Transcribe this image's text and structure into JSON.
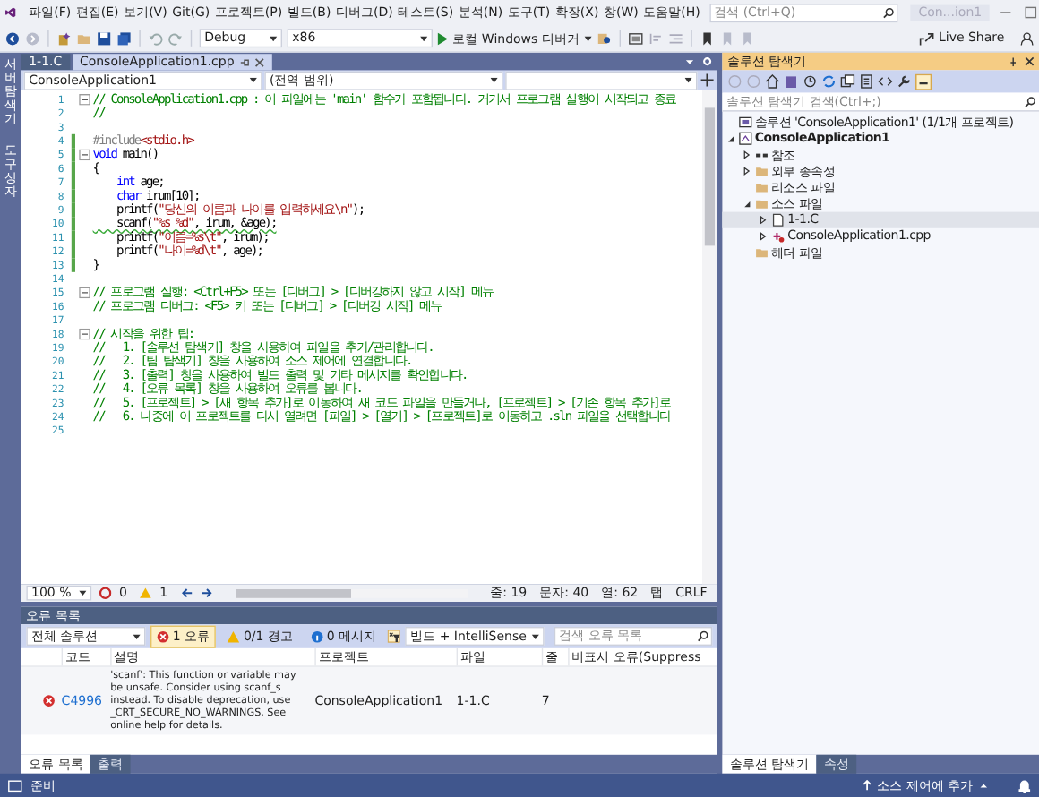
{
  "menu": [
    "파일(F)",
    "편집(E)",
    "보기(V)",
    "Git(G)",
    "프로젝트(P)",
    "빌드(B)",
    "디버그(D)",
    "테스트(S)",
    "분석(N)",
    "도구(T)",
    "확장(X)",
    "창(W)",
    "도움말(H)"
  ],
  "search": {
    "placeholder": "검색 (Ctrl+Q)"
  },
  "window": {
    "title": "Con...ion1"
  },
  "toolbar": {
    "configuration": "Debug",
    "platform": "x86",
    "run_label": "로컬 Windows 디버거",
    "live_share": "Live Share"
  },
  "side_strip": [
    "서버 탐색기",
    "도구 상자"
  ],
  "doc_tabs": [
    {
      "label": "1-1.C",
      "selected": false
    },
    {
      "label": "ConsoleApplication1.cpp",
      "selected": true
    }
  ],
  "nav_bar": {
    "project": "ConsoleApplication1",
    "scope": "(전역 범위)"
  },
  "code_lines": [
    {
      "number": "1",
      "fold": true,
      "changed": false,
      "segments": [
        {
          "kind": "comment",
          "text": "// ConsoleApplication1.cpp : 이 파일에는 'main' 함수가 포함됩니다. 거기서 프로그램 실행이 시작되고 종료"
        }
      ]
    },
    {
      "number": "2",
      "fold": false,
      "changed": false,
      "segments": [
        {
          "kind": "comment",
          "text": "//"
        }
      ]
    },
    {
      "number": "3",
      "fold": false,
      "changed": false
    },
    {
      "number": "4",
      "fold": false,
      "changed": true,
      "segments": [
        {
          "kind": "preproc",
          "text": "#include"
        },
        {
          "kind": "string",
          "text": "<stdio.h>"
        }
      ]
    },
    {
      "number": "5",
      "fold": true,
      "changed": true,
      "segments": [
        {
          "kind": "keyword",
          "text": "void"
        },
        {
          "kind": "plain",
          "text": " main()"
        }
      ]
    },
    {
      "number": "6",
      "fold": false,
      "changed": true,
      "segments": [
        {
          "kind": "plain",
          "text": "{"
        }
      ]
    },
    {
      "number": "7",
      "fold": false,
      "changed": true,
      "segments": [
        {
          "kind": "keyword",
          "text": "    int"
        },
        {
          "kind": "plain",
          "text": " age;"
        }
      ]
    },
    {
      "number": "8",
      "fold": false,
      "changed": true,
      "segments": [
        {
          "kind": "keyword",
          "text": "    char"
        },
        {
          "kind": "plain",
          "text": " irum[10];"
        }
      ]
    },
    {
      "number": "9",
      "fold": false,
      "changed": true,
      "segments": [
        {
          "kind": "plain",
          "text": "    printf("
        },
        {
          "kind": "string",
          "text": "\"당신의 이름과 나이를 입력하세요\\n\""
        },
        {
          "kind": "plain",
          "text": ");"
        }
      ]
    },
    {
      "number": "10",
      "fold": false,
      "changed": true,
      "squiggle": true,
      "segments": [
        {
          "kind": "plain",
          "text": "    scanf("
        },
        {
          "kind": "string",
          "text": "\"%s %d\""
        },
        {
          "kind": "plain",
          "text": ", irum, &age);"
        }
      ]
    },
    {
      "number": "11",
      "fold": false,
      "changed": true,
      "segments": [
        {
          "kind": "plain",
          "text": "    printf("
        },
        {
          "kind": "string",
          "text": "\"이름=%s\\t\""
        },
        {
          "kind": "plain",
          "text": ", irum);"
        }
      ]
    },
    {
      "number": "12",
      "fold": false,
      "changed": true,
      "segments": [
        {
          "kind": "plain",
          "text": "    printf("
        },
        {
          "kind": "string",
          "text": "\"나이=%d\\t\""
        },
        {
          "kind": "plain",
          "text": ", age);"
        }
      ]
    },
    {
      "number": "13",
      "fold": false,
      "changed": true,
      "segments": [
        {
          "kind": "plain",
          "text": "}"
        }
      ]
    },
    {
      "number": "14",
      "fold": false,
      "changed": false
    },
    {
      "number": "15",
      "fold": true,
      "changed": false,
      "segments": [
        {
          "kind": "comment",
          "text": "// 프로그램 실행: <Ctrl+F5> 또는 [디버그] > [디버깅하지 않고 시작] 메뉴"
        }
      ]
    },
    {
      "number": "16",
      "fold": false,
      "changed": false,
      "segments": [
        {
          "kind": "comment",
          "text": "// 프로그램 디버그: <F5> 키 또는 [디버그] > [디버깅 시작] 메뉴"
        }
      ]
    },
    {
      "number": "17",
      "fold": false,
      "changed": false
    },
    {
      "number": "18",
      "fold": true,
      "changed": false,
      "segments": [
        {
          "kind": "comment",
          "text": "// 시작을 위한 팁:"
        }
      ]
    },
    {
      "number": "19",
      "fold": false,
      "changed": false,
      "segments": [
        {
          "kind": "comment",
          "text": "//   1. [솔루션 탐색기] 창을 사용하여 파일을 추가/관리합니다."
        }
      ]
    },
    {
      "number": "20",
      "fold": false,
      "changed": false,
      "segments": [
        {
          "kind": "comment",
          "text": "//   2. [팀 탐색기] 창을 사용하여 소스 제어에 연결합니다."
        }
      ]
    },
    {
      "number": "21",
      "fold": false,
      "changed": false,
      "segments": [
        {
          "kind": "comment",
          "text": "//   3. [출력] 창을 사용하여 빌드 출력 및 기타 메시지를 확인합니다."
        }
      ]
    },
    {
      "number": "22",
      "fold": false,
      "changed": false,
      "segments": [
        {
          "kind": "comment",
          "text": "//   4. [오류 목록] 창을 사용하여 오류를 봅니다."
        }
      ]
    },
    {
      "number": "23",
      "fold": false,
      "changed": false,
      "segments": [
        {
          "kind": "comment",
          "text": "//   5. [프로젝트] > [새 항목 추가]로 이동하여 새 코드 파일을 만들거나, [프로젝트] > [기존 항목 추가]로"
        }
      ]
    },
    {
      "number": "24",
      "fold": false,
      "changed": false,
      "segments": [
        {
          "kind": "comment",
          "text": "//   6. 나중에 이 프로젝트를 다시 열려면 [파일] > [열기] > [프로젝트]로 이동하고 .sln 파일을 선택합니다"
        }
      ]
    },
    {
      "number": "25",
      "fold": false,
      "changed": false
    }
  ],
  "editor_status": {
    "zoom": "100 %",
    "errors": "0",
    "warnings": "1",
    "line": "줄: 19",
    "char": "문자: 40",
    "col": "열: 62",
    "indent": "탭",
    "eol": "CRLF"
  },
  "error_list": {
    "title": "오류 목록",
    "scope": "전체 솔루션",
    "filters": [
      {
        "kind": "error",
        "label": "1 오류",
        "selected": true
      },
      {
        "kind": "warning",
        "label": "0/1 경고",
        "selected": false
      },
      {
        "kind": "message",
        "label": "0 메시지",
        "selected": false
      }
    ],
    "source": "빌드 + IntelliSense",
    "search_placeholder": "검색 오류 목록",
    "columns": [
      "코드",
      "설명",
      "프로젝트",
      "파일",
      "줄",
      "비표시 오류(Suppress"
    ],
    "rows": [
      {
        "kind": "error",
        "code": "C4996",
        "description": "'scanf': This function or variable may be unsafe. Consider using scanf_s instead. To disable deprecation, use _CRT_SECURE_NO_WARNINGS. See online help for details.",
        "project": "ConsoleApplication1",
        "file": "1-1.C",
        "line": "7"
      }
    ],
    "tabs": [
      {
        "label": "오류 목록",
        "selected": true
      },
      {
        "label": "출력",
        "selected": false
      }
    ]
  },
  "solution_explorer": {
    "title": "솔루션 탐색기",
    "search_placeholder": "솔루션 탐색기 검색(Ctrl+;)",
    "tree": [
      {
        "kind": "solution",
        "label": "솔루션 'ConsoleApplication1' (1/1개 프로젝트)",
        "selected": false,
        "children": [
          {
            "kind": "project",
            "label": "ConsoleApplication1",
            "expanded": true,
            "selected": false,
            "children": [
              {
                "kind": "references",
                "label": "참조",
                "expanded": false,
                "selected": false
              },
              {
                "kind": "folder",
                "label": "외부 종속성",
                "expanded": false,
                "selected": false
              },
              {
                "kind": "folder",
                "label": "리소스 파일",
                "selected": false
              },
              {
                "kind": "folder",
                "label": "소스 파일",
                "expanded": true,
                "selected": false,
                "children": [
                  {
                    "kind": "c_file",
                    "label": "1-1.C",
                    "expanded": false,
                    "selected": true
                  },
                  {
                    "kind": "cpp_file",
                    "label": "ConsoleApplication1.cpp",
                    "expanded": false,
                    "selected": false
                  }
                ]
              },
              {
                "kind": "folder",
                "label": "헤더 파일",
                "selected": false
              }
            ]
          }
        ]
      }
    ],
    "tabs": [
      {
        "label": "솔루션 탐색기",
        "selected": true
      },
      {
        "label": "속성",
        "selected": false
      }
    ]
  },
  "status_bar": {
    "text": "준비",
    "source_control": "소스 제어에 추가"
  }
}
